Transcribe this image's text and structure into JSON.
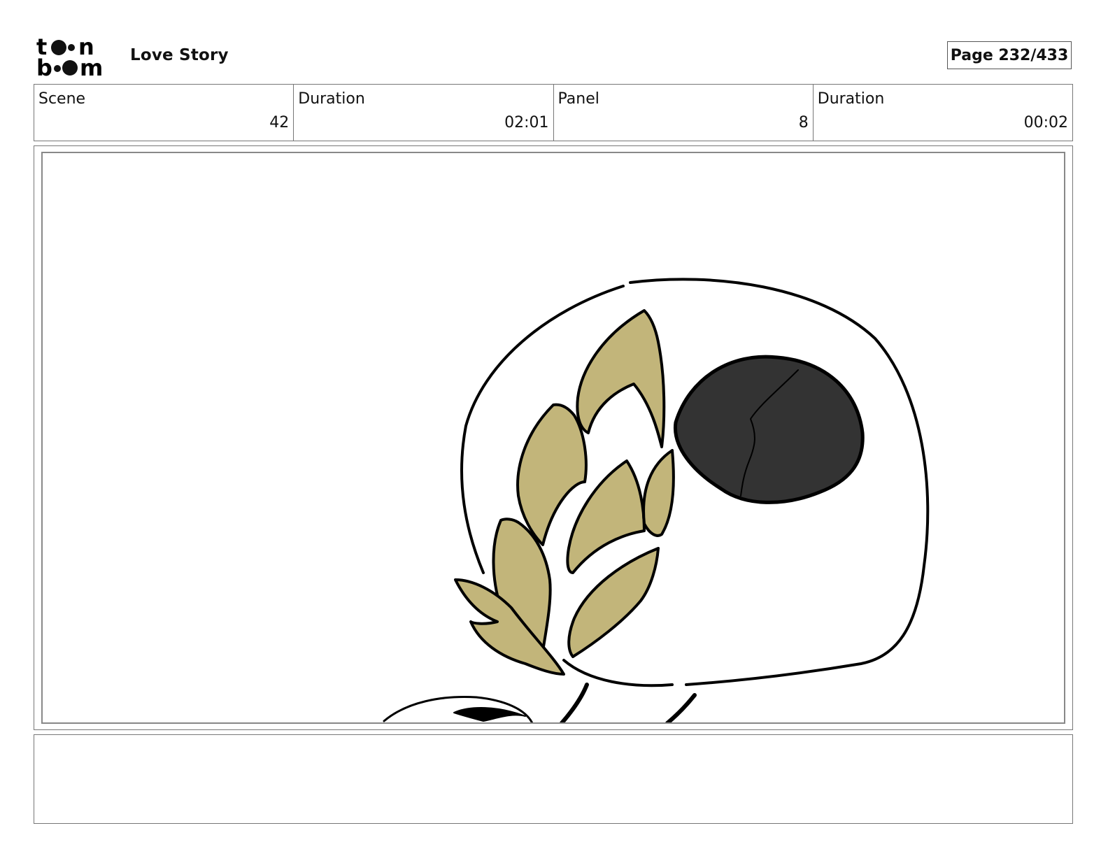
{
  "header": {
    "logo_text": "toon boom",
    "project_title": "Love Story",
    "page_label": "Page 232/433"
  },
  "info": [
    {
      "label": "Scene",
      "value": "42"
    },
    {
      "label": "Duration",
      "value": "02:01"
    },
    {
      "label": "Panel",
      "value": "8"
    },
    {
      "label": "Duration",
      "value": "00:02"
    }
  ],
  "panel": {
    "leaf_color": "#c2b57a",
    "eye_color": "#333333",
    "line_color": "#000000"
  },
  "notes": {
    "text": ""
  }
}
